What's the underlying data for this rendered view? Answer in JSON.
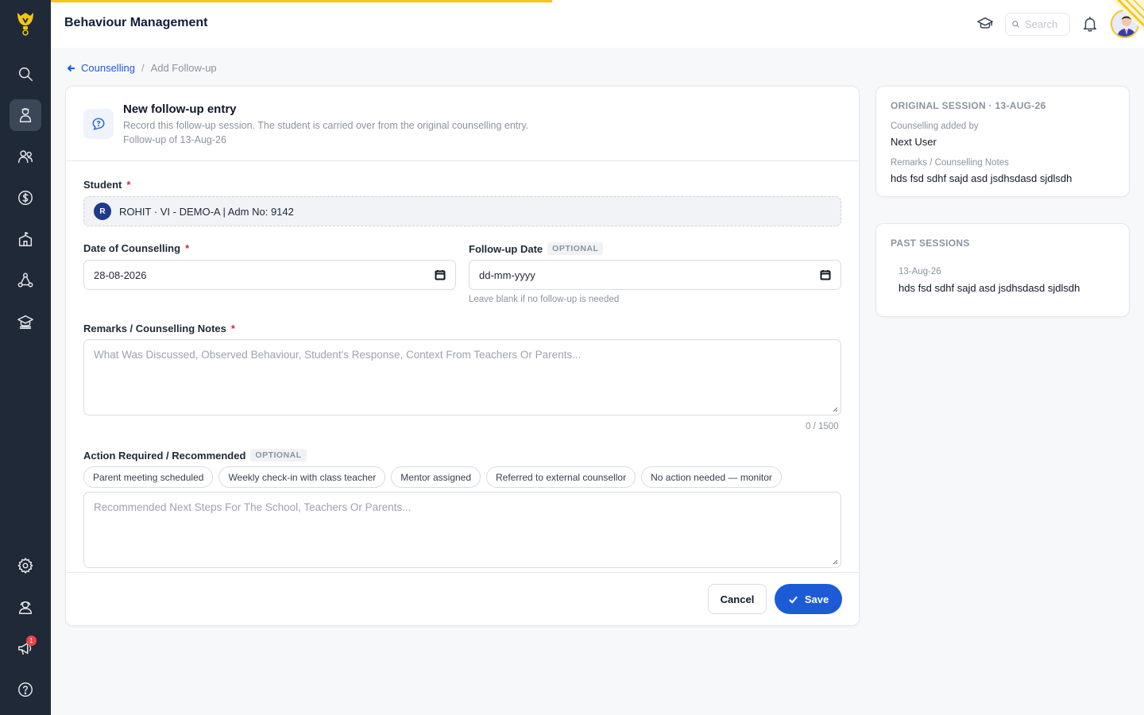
{
  "app": {
    "page_title": "Behaviour Management",
    "search_placeholder": "Search",
    "notification_count": "1"
  },
  "breadcrumb": {
    "parent": "Counselling",
    "separator": "/",
    "current": "Add Follow-up"
  },
  "form": {
    "heading": "New follow-up entry",
    "description": "Record this follow-up session. The student is carried over from the original counselling entry.",
    "follow_up_of": "Follow-up of 13-Aug-26",
    "student_label": "Student",
    "required_mark": "*",
    "student_initial": "R",
    "student_value": "ROHIT · VI - DEMO-A | Adm No: 9142",
    "date_label": "Date of Counselling",
    "date_value": "28-08-2026",
    "followup_label": "Follow-up Date",
    "optional_badge": "OPTIONAL",
    "followup_placeholder": "dd-mm-yyyy",
    "followup_hint": "Leave blank if no follow-up is needed",
    "remarks_label": "Remarks / Counselling Notes",
    "remarks_placeholder": "What Was Discussed, Observed Behaviour, Student's Response, Context From Teachers Or Parents...",
    "remarks_counter": "0 / 1500",
    "action_label": "Action Required / Recommended",
    "action_chips": [
      "Parent meeting scheduled",
      "Weekly check-in with class teacher",
      "Mentor assigned",
      "Referred to external counsellor",
      "No action needed — monitor"
    ],
    "action_placeholder": "Recommended Next Steps For The School, Teachers Or Parents...",
    "cancel_label": "Cancel",
    "save_label": "Save"
  },
  "original_session": {
    "title": "ORIGINAL SESSION · 13-AUG-26",
    "added_by_label": "Counselling added by",
    "added_by_value": "Next User",
    "remarks_label": "Remarks / Counselling Notes",
    "remarks_value": "hds fsd sdhf sajd asd jsdhsdasd sjdlsdh"
  },
  "past_sessions": {
    "title": "PAST SESSIONS",
    "items": [
      {
        "date": "13-Aug-26",
        "note": "hds fsd sdhf sajd asd jsdhsdasd sjdlsdh"
      }
    ]
  },
  "colors": {
    "sidebar": "#1f2937",
    "accent": "#1d5bd6",
    "brand_yellow": "#f5c518",
    "required": "#e11d48"
  }
}
